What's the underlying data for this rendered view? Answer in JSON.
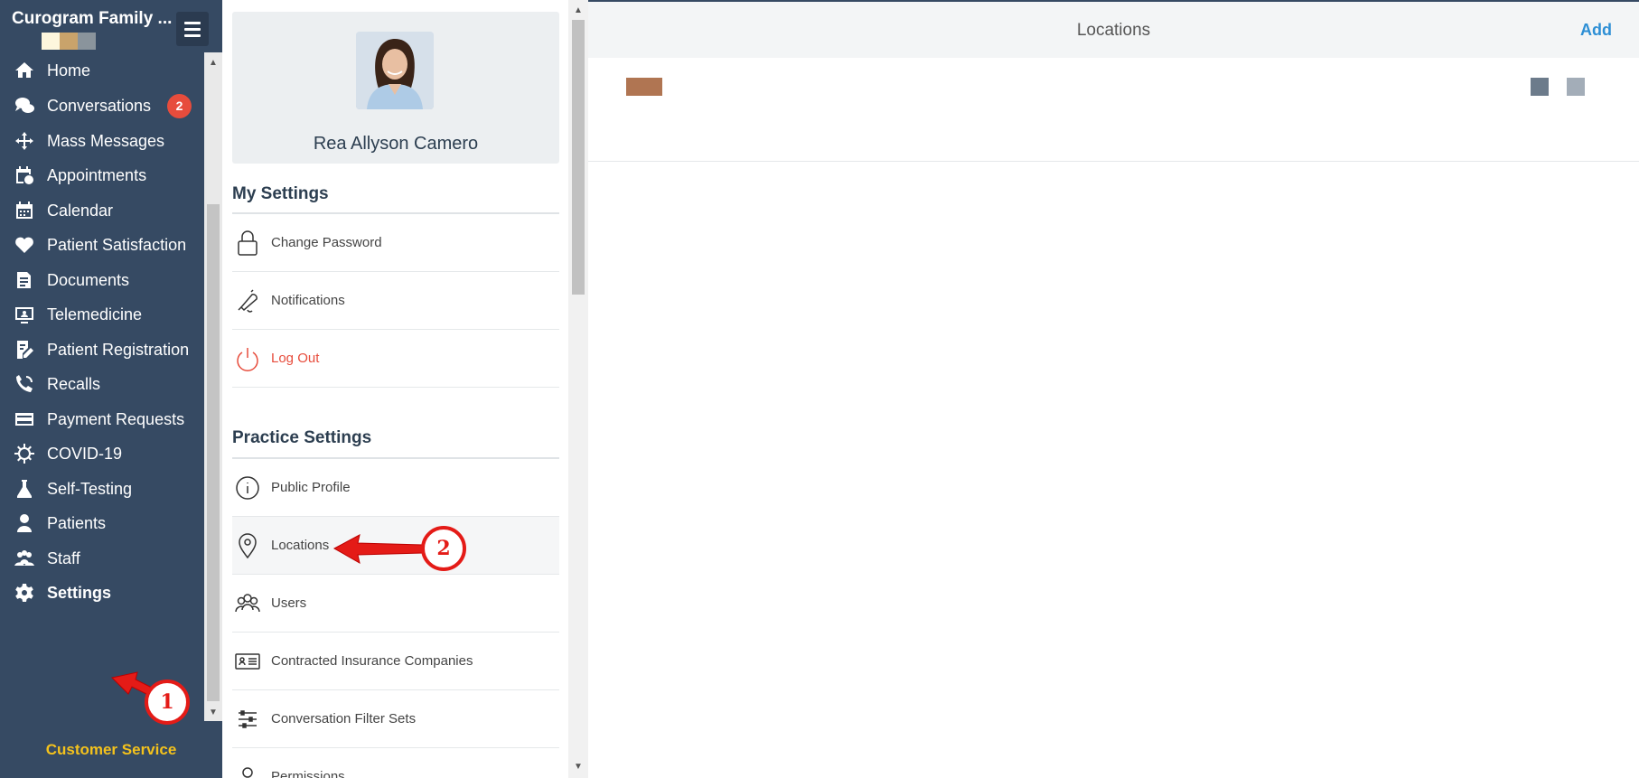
{
  "sidebar": {
    "brand_title": "Curogram Family ...",
    "brand_colors": [
      "#fdf6dd",
      "#c9a36b",
      "#8a949c"
    ],
    "items": [
      {
        "label": "Home",
        "icon": "home-icon"
      },
      {
        "label": "Conversations",
        "icon": "chat-icon",
        "badge": "2"
      },
      {
        "label": "Mass Messages",
        "icon": "broadcast-icon"
      },
      {
        "label": "Appointments",
        "icon": "calendar-clock-icon"
      },
      {
        "label": "Calendar",
        "icon": "calendar-icon"
      },
      {
        "label": "Patient Satisfaction",
        "icon": "heart-icon"
      },
      {
        "label": "Documents",
        "icon": "documents-icon"
      },
      {
        "label": "Telemedicine",
        "icon": "telemedicine-icon"
      },
      {
        "label": "Patient Registration",
        "icon": "registration-icon"
      },
      {
        "label": "Recalls",
        "icon": "phone-recall-icon"
      },
      {
        "label": "Payment Requests",
        "icon": "credit-card-icon"
      },
      {
        "label": "COVID-19",
        "icon": "virus-icon"
      },
      {
        "label": "Self-Testing",
        "icon": "flask-icon"
      },
      {
        "label": "Patients",
        "icon": "patient-icon"
      },
      {
        "label": "Staff",
        "icon": "staff-icon"
      },
      {
        "label": "Settings",
        "icon": "gear-icon",
        "active": true
      }
    ],
    "customer_service": "Customer Service"
  },
  "settings_panel": {
    "profile_name": "Rea Allyson Camero",
    "my_settings_title": "My Settings",
    "my_settings_items": [
      {
        "label": "Change Password",
        "icon": "lock-icon"
      },
      {
        "label": "Notifications",
        "icon": "bell-icon"
      },
      {
        "label": "Log Out",
        "icon": "power-icon"
      }
    ],
    "practice_settings_title": "Practice Settings",
    "practice_settings_items": [
      {
        "label": "Public Profile",
        "icon": "info-icon"
      },
      {
        "label": "Locations",
        "icon": "map-pin-icon"
      },
      {
        "label": "Users",
        "icon": "users-icon"
      },
      {
        "label": "Contracted Insurance Companies",
        "icon": "id-card-icon"
      },
      {
        "label": "Conversation Filter Sets",
        "icon": "sliders-icon"
      },
      {
        "label": "Permissions",
        "icon": "person-icon"
      }
    ]
  },
  "main": {
    "title": "Locations",
    "add_label": "Add",
    "location_swatch_color": "#b07552"
  },
  "annotations": {
    "callout_1": "1",
    "callout_2": "2",
    "color": "#e41b17"
  }
}
